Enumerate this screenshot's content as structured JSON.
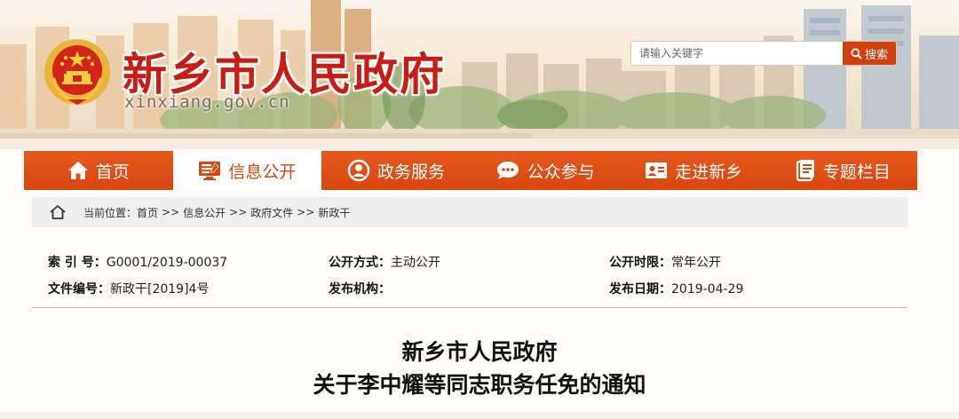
{
  "header": {
    "site_name": "新乡市人民政府",
    "domain": "xinxiang.gov.cn",
    "search": {
      "placeholder": "请输入关键字",
      "button_label": "搜索"
    }
  },
  "nav": {
    "items": [
      {
        "label": "首页",
        "icon": "home-icon"
      },
      {
        "label": "信息公开",
        "icon": "monitor-icon",
        "active": true
      },
      {
        "label": "政务服务",
        "icon": "service-icon"
      },
      {
        "label": "公众参与",
        "icon": "chat-icon"
      },
      {
        "label": "走进新乡",
        "icon": "id-card-icon"
      },
      {
        "label": "专题栏目",
        "icon": "document-icon"
      }
    ]
  },
  "breadcrumb": {
    "prefix": "当前位置：",
    "items": [
      "首页",
      "信息公开",
      "政府文件",
      "新政干"
    ],
    "separator": ">>"
  },
  "meta": {
    "index_label": "索 引 号：",
    "index_value": "G0001/2019-00037",
    "method_label": "公开方式：",
    "method_value": "主动公开",
    "period_label": "公开时限：",
    "period_value": "常年公开",
    "docno_label": "文件编号：",
    "docno_value": "新政干[2019]4号",
    "org_label": "发布机构：",
    "org_value": "",
    "date_label": "发布日期：",
    "date_value": "2019-04-29"
  },
  "document": {
    "title_line1": "新乡市人民政府",
    "title_line2": "关于李中耀等同志职务任免的通知"
  },
  "colors": {
    "accent": "#d9450f",
    "title_red": "#c91c12"
  }
}
